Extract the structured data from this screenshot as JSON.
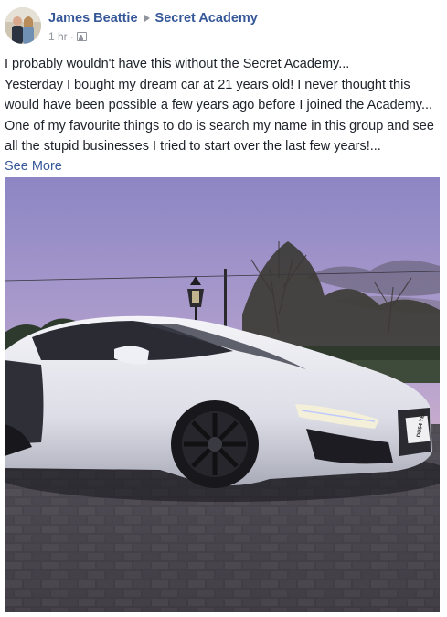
{
  "post": {
    "author": "James Beattie",
    "group": "Secret Academy",
    "time": "1 hr",
    "separator": "·",
    "privacy_icon": "group-members-icon",
    "paragraphs": [
      "I probably wouldn't have this without the Secret Academy...",
      "Yesterday I bought my dream car at 21 years old! I never thought this would have been possible a few years ago before I joined the Academy...",
      "One of my favourite things to do is search my name in this group and see all the stupid businesses I tried to start over the last few years!..."
    ],
    "see_more": "See More",
    "photo": {
      "description_icon": "car-photo",
      "plate_text": "DU64 YBU"
    }
  },
  "colors": {
    "link": "#365899",
    "text": "#1d2129",
    "meta": "#90949c"
  }
}
